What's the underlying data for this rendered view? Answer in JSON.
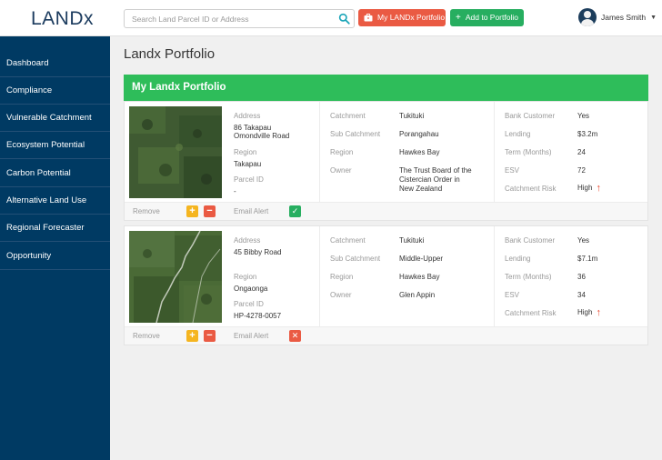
{
  "app": {
    "logo": "LANDx"
  },
  "header": {
    "search_placeholder": "Search Land Parcel ID or Address",
    "portfolio_button": "My LANDx Portfolio",
    "add_button": "Add to Portfolio",
    "user_name": "James Smith"
  },
  "sidebar": {
    "items": [
      {
        "label": "Dashboard"
      },
      {
        "label": "Compliance"
      },
      {
        "label": "Vulnerable Catchment"
      },
      {
        "label": "Ecosystem Potential"
      },
      {
        "label": "Carbon Potential"
      },
      {
        "label": "Alternative Land Use"
      },
      {
        "label": "Regional Forecaster"
      },
      {
        "label": "Opportunity"
      }
    ]
  },
  "main": {
    "page_title": "Landx Portfolio",
    "panel_title": "My Landx Portfolio"
  },
  "labels": {
    "address": "Address",
    "region": "Region",
    "parcel_id": "Parcel ID",
    "catchment": "Catchment",
    "sub_catchment": "Sub Catchment",
    "owner": "Owner",
    "bank_customer": "Bank Customer",
    "lending": "Lending",
    "term": "Term (Months)",
    "esv": "ESV",
    "catchment_risk": "Catchment Risk",
    "remove": "Remove",
    "email_alert": "Email Alert"
  },
  "cards": [
    {
      "address_line1": "86 Takapau",
      "address_line2": "Omondville Road",
      "region": "Takapau",
      "parcel_id": "-",
      "catchment": "Tukituki",
      "sub_catchment": "Porangahau",
      "catchment_region": "Hawkes Bay",
      "owner_line1": "The Trust Board of the",
      "owner_line2": "Cistercian Order in",
      "owner_line3": "New Zealand",
      "bank_customer": "Yes",
      "lending": "$3.2m",
      "term": "24",
      "esv": "72",
      "catchment_risk": "High",
      "email_alert": true
    },
    {
      "address_line1": "45 Bibby Road",
      "address_line2": "",
      "region": "Ongaonga",
      "parcel_id": "HP-4278-0057",
      "catchment": "Tukituki",
      "sub_catchment": "Middle-Upper",
      "catchment_region": "Hawkes Bay",
      "owner_line1": "Glen Appin",
      "owner_line2": "",
      "owner_line3": "",
      "bank_customer": "Yes",
      "lending": "$7.1m",
      "term": "36",
      "esv": "34",
      "catchment_risk": "High",
      "email_alert": false
    }
  ],
  "icons": {
    "search": "search-icon",
    "briefcase": "briefcase-icon",
    "plus": "plus-icon",
    "avatar": "user-avatar",
    "caret": "caret-down-icon",
    "risk": "arrow-up-icon",
    "check": "check-icon",
    "cross": "close-icon"
  },
  "colors": {
    "sidebar": "#003a63",
    "accent_green": "#2ebd5a",
    "button_red": "#ea5a43",
    "button_green": "#27ae60",
    "plus_yellow": "#f5b520"
  }
}
